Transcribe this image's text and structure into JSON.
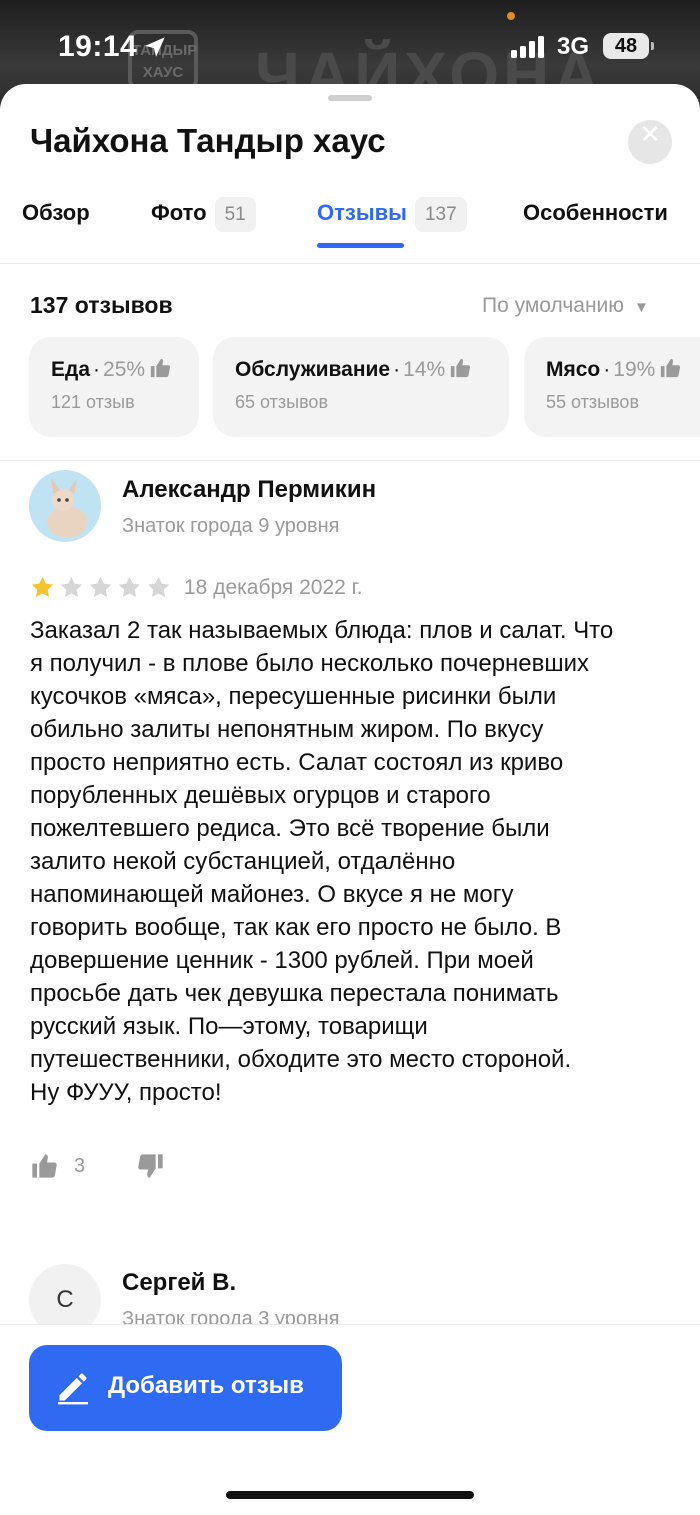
{
  "status_bar": {
    "time": "19:14",
    "network": "3G",
    "battery": "48"
  },
  "background": {
    "sign_small": "ТАНДЫР\nХАУС",
    "sign_big": "ЧАЙХОНА"
  },
  "header": {
    "title": "Чайхона Тандыр хаус",
    "close_icon": "close-icon"
  },
  "tabs": [
    {
      "label": "Обзор",
      "count": ""
    },
    {
      "label": "Фото",
      "count": "51"
    },
    {
      "label": "Отзывы",
      "count": "137",
      "active": true
    },
    {
      "label": "Особенности",
      "count": ""
    }
  ],
  "reviews_header": {
    "count_label": "137 отзывов",
    "sort_label": "По умолчанию"
  },
  "chips": [
    {
      "name": "Еда",
      "percent": "25%",
      "sub": "121 отзыв"
    },
    {
      "name": "Обслуживание",
      "percent": "14%",
      "sub": "65 отзывов"
    },
    {
      "name": "Мясо",
      "percent": "19%",
      "sub": "55 отзывов"
    }
  ],
  "reviews": [
    {
      "author": "Александр Пермикин",
      "level": "Знаток города 9 уровня",
      "rating": 1,
      "rating_max": 5,
      "date": "18 декабря 2022 г.",
      "text": "Заказал 2 так называемых блюда: плов и салат. Что\nя получил - в плове было несколько почерневших\nкусочков «мяса», пересушенные рисинки были\nобильно залиты непонятным жиром. По вкусу\nпросто неприятно есть. Салат состоял из криво\nпорубленных дешёвых огурцов и старого\nпожелтевшего редиса. Это всё творение были\nзалито некой субстанцией, отдалённо\nнапоминающей майонез. О вкусе я не могу\nговорить вообще, так как его просто не было. В\nдовершение ценник - 1300 рублей. При моей\nпросьбе дать чек девушка перестала понимать\nрусский язык. По—этому, товарищи\nпутешественники, обходите это место стороной.\nНу ФУУУ, просто!",
      "likes": "3"
    },
    {
      "author": "Сергей В.",
      "level": "Знаток города 3 уровня",
      "avatar_letter": "С"
    }
  ],
  "footer": {
    "add_review_label": "Добавить отзыв"
  },
  "colors": {
    "accent": "#2f6bf2",
    "star_active": "#f6c431",
    "star_inactive": "#d6d6d6"
  }
}
